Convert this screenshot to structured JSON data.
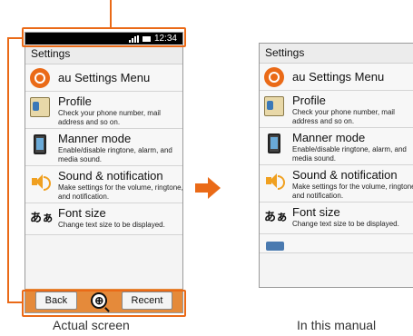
{
  "status_bar": {
    "time": "12:34",
    "signal": "signal-icon",
    "battery": "battery-icon"
  },
  "screen": {
    "title": "Settings",
    "items": [
      {
        "label": "au Settings Menu",
        "icon": "gear-icon"
      },
      {
        "label": "Profile",
        "description": "Check your phone number, mail address and so on.",
        "icon": "profile-card-icon"
      },
      {
        "label": "Manner mode",
        "description": "Enable/disable ringtone, alarm, and media sound.",
        "icon": "phone-vibrate-icon"
      },
      {
        "label": "Sound & notification",
        "description": "Make settings for the volume, ringtone, and notification.",
        "icon": "speaker-icon"
      },
      {
        "label": "Font size",
        "description": "Change text size to be displayed.",
        "icon": "font-icon",
        "icon_text": "あぁ"
      }
    ]
  },
  "nav_bar": {
    "back": "Back",
    "zoom": "⊕",
    "recent": "Recent"
  },
  "captions": {
    "actual": "Actual screen",
    "manual": "In this manual"
  },
  "colors": {
    "accent": "#ea6a17",
    "nav_bar": "#e58a3a",
    "status_bar": "#000000"
  }
}
